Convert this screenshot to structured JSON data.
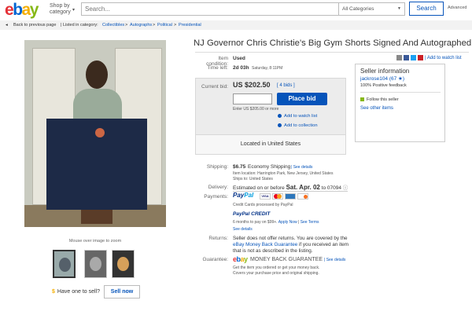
{
  "header": {
    "logo": {
      "e": "e",
      "b": "b",
      "a": "a",
      "y": "y"
    },
    "shop_by": "Shop by",
    "shop_by_sub": "category",
    "search_placeholder": "Search...",
    "category_select": "All Categories",
    "search_button": "Search",
    "advanced": "Advanced"
  },
  "breadcrumb": {
    "back": "Back to previous page",
    "listed_in": "| Listed in category:",
    "path": [
      "Collectibles",
      "Autographs",
      "Political",
      "Presidential"
    ]
  },
  "item": {
    "title": "NJ Governor Chris Christie's Big Gym Shorts Signed And Autographed",
    "condition_label": "Item condition:",
    "condition_value": "Used",
    "time_left_label": "Time left:",
    "time_left_value": "2d 03h",
    "time_left_detail": "Saturday, 8:11PM",
    "current_bid_label": "Current bid:",
    "current_bid_value": "US $202.50",
    "bids": "[ 4 bids ]",
    "place_bid": "Place bid",
    "enter_note": "Enter US $205.00 or more",
    "add_watch": "Add to watch list",
    "add_collection": "Add to collection",
    "location": "Located in United States"
  },
  "share": {
    "add_watch": "| Add to watch list"
  },
  "seller": {
    "title": "Seller information",
    "name": "jackrose104 (67 ★)",
    "feedback": "100% Positive feedback",
    "follow": "Follow this seller",
    "other_items": "See other items"
  },
  "shipping": {
    "label": "Shipping:",
    "value": "$6.75",
    "method": "Economy Shipping",
    "see_details": "| See details",
    "item_location": "Item location: Harrington Park, New Jersey, United States",
    "ships_to": "Ships to: United States"
  },
  "delivery": {
    "label": "Delivery:",
    "prefix": "Estimated on or before",
    "date": "Sat. Apr. 02",
    "suffix": "to 07094"
  },
  "payments": {
    "label": "Payments:",
    "paypal_a": "Pay",
    "paypal_b": "Pal",
    "cards_note": "Credit Cards processed by PayPal",
    "credit": "PayPal CREDIT",
    "credit_note": "6 months to pay on $99+.",
    "apply_now": "Apply Now",
    "see_terms": "See Terms",
    "see_details": "See details"
  },
  "returns": {
    "label": "Returns:",
    "line1": "Seller does not offer returns. You are covered by the",
    "line2": "eBay Money Back Guarantee",
    "line2b": "if you received an item",
    "line3": "that is not as described in the listing."
  },
  "guarantee": {
    "label": "Guarantee:",
    "brand": "ebay",
    "text": "MONEY BACK GUARANTEE",
    "see_details": "| See details",
    "line1": "Get the item you ordered or get your money back.",
    "line2": "Covers your purchase price and original shipping."
  },
  "gallery": {
    "mouseover": "Mouse over image to zoom"
  },
  "sell": {
    "text": "Have one to sell?",
    "button": "Sell now"
  }
}
